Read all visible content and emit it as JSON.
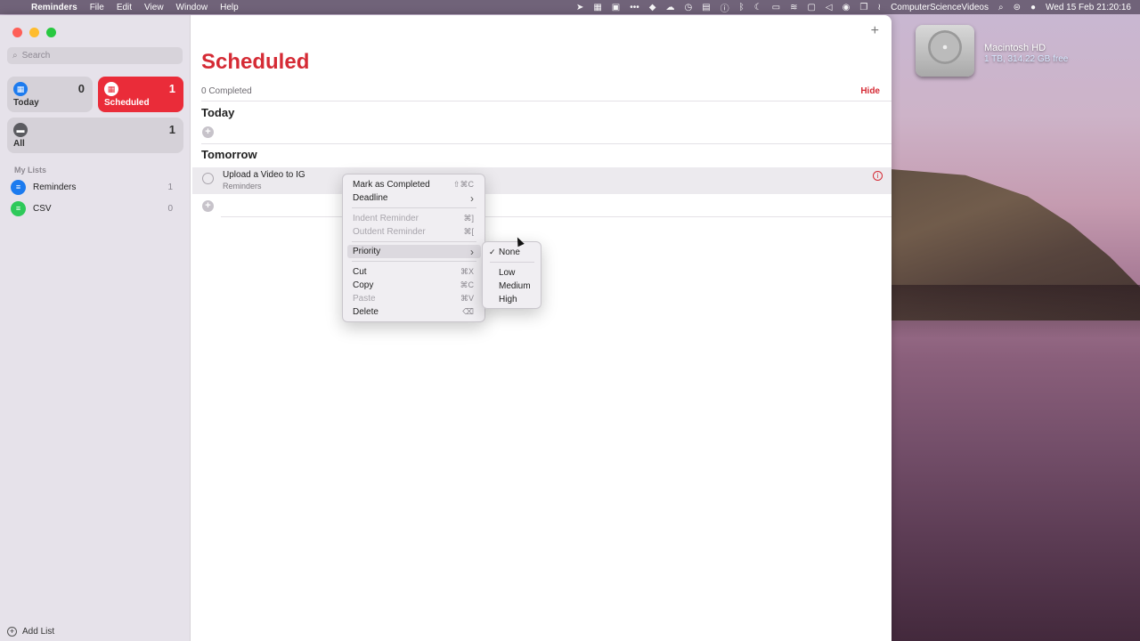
{
  "menubar": {
    "app_name": "Reminders",
    "menus": [
      "File",
      "Edit",
      "View",
      "Window",
      "Help"
    ],
    "user": "ComputerScienceVideos",
    "datetime": "Wed 15 Feb  21:20:16"
  },
  "desktop": {
    "drive_name": "Macintosh HD",
    "drive_info": "1 TB, 314.22 GB free"
  },
  "sidebar": {
    "search_placeholder": "Search",
    "smart_lists": {
      "today": {
        "label": "Today",
        "count": "0"
      },
      "scheduled": {
        "label": "Scheduled",
        "count": "1"
      },
      "all": {
        "label": "All",
        "count": "1"
      }
    },
    "my_lists_header": "My Lists",
    "lists": [
      {
        "name": "Reminders",
        "count": "1",
        "color": "#1c7bef"
      },
      {
        "name": "CSV",
        "count": "0",
        "color": "#2ec95a"
      }
    ],
    "add_list": "Add List"
  },
  "main": {
    "add_symbol": "+",
    "title": "Scheduled",
    "completed_text": "0 Completed",
    "hide_label": "Hide",
    "sections": {
      "today": "Today",
      "tomorrow": "Tomorrow"
    },
    "task": {
      "title": "Upload a Video to IG",
      "list": "Reminders"
    }
  },
  "context_menu": {
    "items": [
      {
        "label": "Mark as Completed",
        "shortcut": "⇧⌘C"
      },
      {
        "label": "Deadline",
        "shortcut": "›"
      },
      {
        "label": "Indent Reminder",
        "shortcut": "⌘]"
      },
      {
        "label": "Outdent Reminder",
        "shortcut": "⌘["
      },
      {
        "label": "Priority",
        "shortcut": "›"
      },
      {
        "label": "Cut",
        "shortcut": "⌘X"
      },
      {
        "label": "Copy",
        "shortcut": "⌘C"
      },
      {
        "label": "Paste",
        "shortcut": "⌘V"
      },
      {
        "label": "Delete",
        "shortcut": "⌫"
      }
    ]
  },
  "priority_submenu": {
    "check": "✓",
    "items": [
      "None",
      "Low",
      "Medium",
      "High"
    ]
  },
  "colors": {
    "accent_red": "#d52b35",
    "today_blue": "#1c7bef"
  }
}
